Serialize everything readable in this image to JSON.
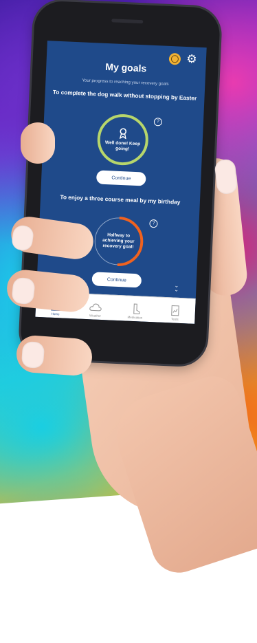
{
  "header": {
    "title": "My goals",
    "subtitle": "Your progress to reaching your recovery goals",
    "avatar_icon": "avatar-icon",
    "settings_icon": "gear-icon"
  },
  "goals": [
    {
      "text": "To complete the dog walk without stopping by Easter",
      "status": "Well done! Keep going!",
      "progress": 1.0,
      "ring_color": "#b7d66b",
      "icon": "award-ribbon-icon",
      "button_label": "Continue"
    },
    {
      "text": "To enjoy a three course meal by my birthday",
      "status": "Halfway to achieving your recovery goal!",
      "progress": 0.5,
      "ring_color": "#f0621f",
      "button_label": "Continue"
    }
  ],
  "tabbar": {
    "items": [
      {
        "label": "Home",
        "icon": "home-icon",
        "active": true
      },
      {
        "label": "Weather",
        "icon": "cloud-icon",
        "active": false
      },
      {
        "label": "Medication",
        "icon": "inhaler-icon",
        "active": false
      },
      {
        "label": "Tests",
        "icon": "chart-document-icon",
        "active": false
      }
    ]
  },
  "colors": {
    "screen_bg": "#1f4a8a",
    "accent_orange": "#f0621f",
    "accent_green": "#b7d66b",
    "avatar": "#f2b233"
  }
}
